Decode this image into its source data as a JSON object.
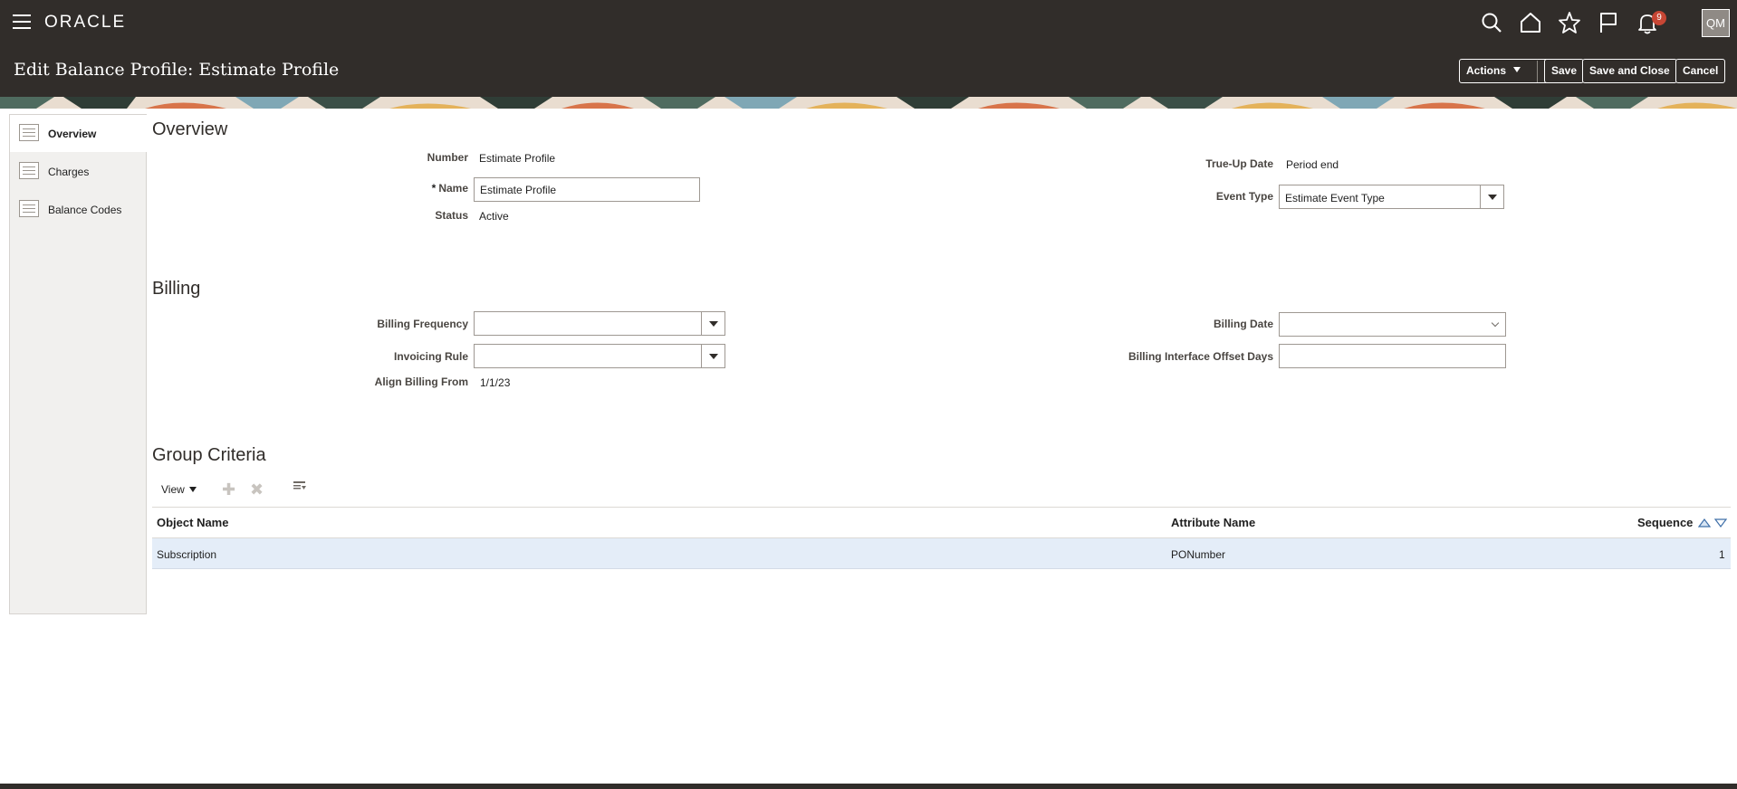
{
  "topbar": {
    "logo": "ORACLE",
    "notification_count": "9",
    "user_initials": "QM",
    "icons": [
      "search-icon",
      "home-icon",
      "star-icon",
      "flag-icon",
      "bell-icon"
    ]
  },
  "header": {
    "title": "Edit Balance Profile: Estimate Profile",
    "actions_label": "Actions",
    "save_label": "Save",
    "save_close_label": "Save and Close",
    "cancel_label": "Cancel"
  },
  "sidebar": {
    "items": [
      {
        "label": "Overview",
        "active": true
      },
      {
        "label": "Charges",
        "active": false
      },
      {
        "label": "Balance Codes",
        "active": false
      }
    ]
  },
  "overview": {
    "heading": "Overview",
    "number_label": "Number",
    "number_value": "Estimate Profile",
    "name_label": "Name",
    "name_required": "*",
    "name_value": "Estimate Profile",
    "status_label": "Status",
    "status_value": "Active",
    "trueup_label": "True-Up Date",
    "trueup_value": "Period end",
    "event_type_label": "Event Type",
    "event_type_value": "Estimate Event Type"
  },
  "billing": {
    "heading": "Billing",
    "frequency_label": "Billing Frequency",
    "frequency_value": "",
    "invoicing_rule_label": "Invoicing Rule",
    "invoicing_rule_value": "",
    "align_label": "Align Billing From",
    "align_value": "1/1/23",
    "billing_date_label": "Billing Date",
    "billing_date_value": "",
    "offset_label": "Billing Interface Offset Days",
    "offset_value": ""
  },
  "group_criteria": {
    "heading": "Group Criteria",
    "view_label": "View",
    "columns": [
      "Object Name",
      "Attribute Name",
      "Sequence"
    ],
    "rows": [
      {
        "object_name": "Subscription",
        "attribute_name": "PONumber",
        "sequence": "1"
      }
    ]
  },
  "colors": {
    "topbar": "#312d2a",
    "row_selected": "#e4edf8",
    "badge": "#c74634"
  }
}
